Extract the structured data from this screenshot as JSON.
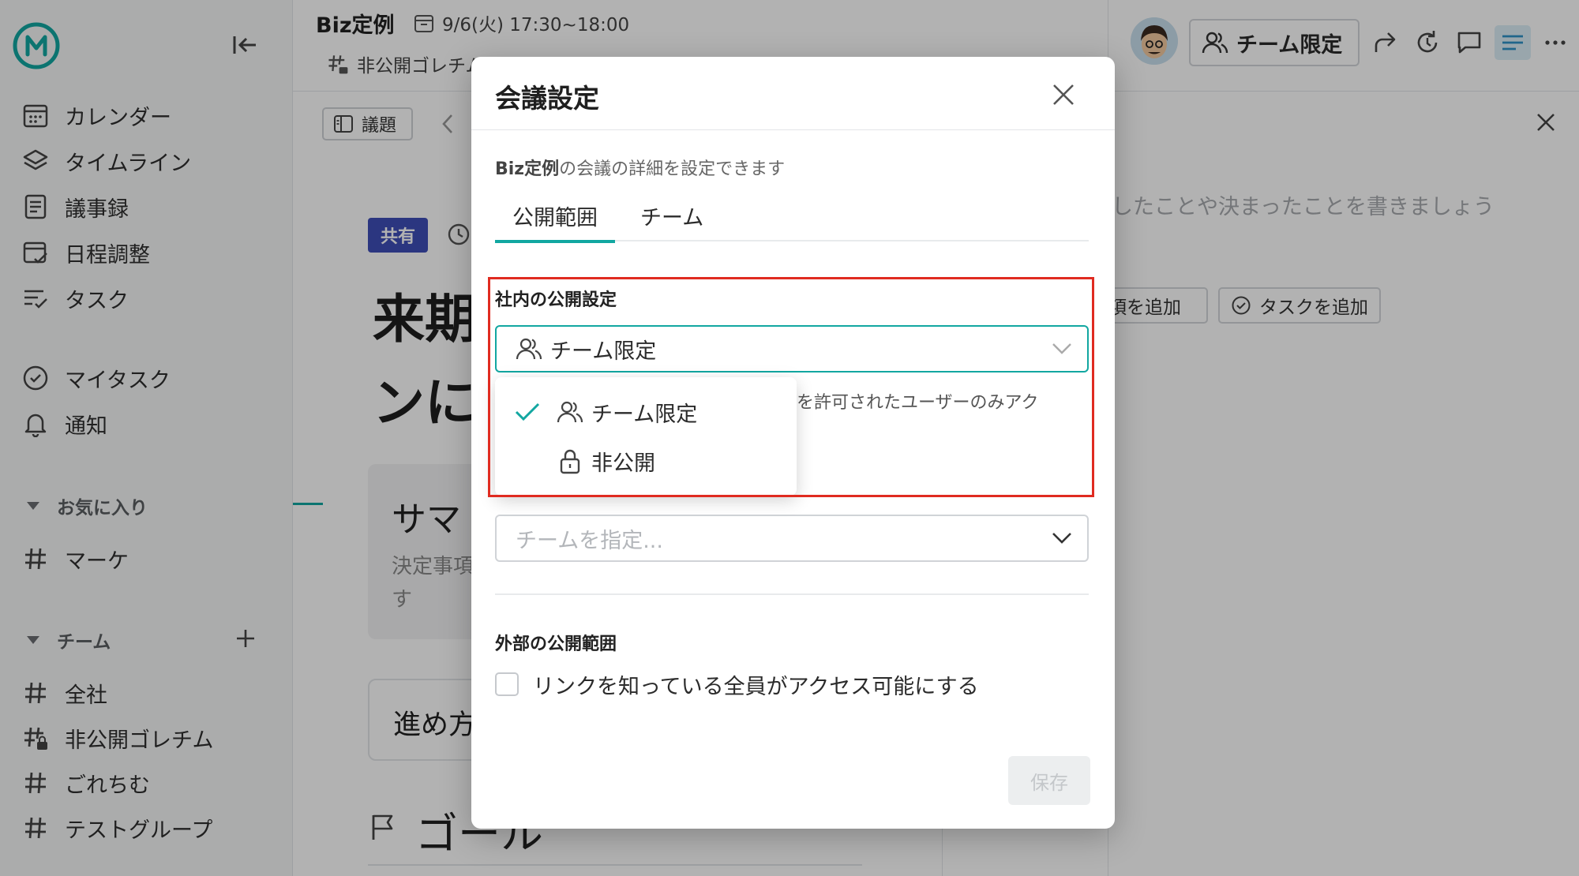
{
  "app": {
    "brand_color": "#12a7a1"
  },
  "sidebar": {
    "nav": [
      {
        "label": "カレンダー",
        "icon": "calendar-icon"
      },
      {
        "label": "タイムライン",
        "icon": "layers-icon"
      },
      {
        "label": "議事録",
        "icon": "document-icon"
      },
      {
        "label": "日程調整",
        "icon": "schedule-icon"
      },
      {
        "label": "タスク",
        "icon": "task-list-icon"
      }
    ],
    "personal": [
      {
        "label": "マイタスク",
        "icon": "check-circle-icon"
      },
      {
        "label": "通知",
        "icon": "bell-icon"
      }
    ],
    "favorites_header": "お気に入り",
    "favorites": [
      {
        "label": "マーケ",
        "icon": "hash-icon"
      }
    ],
    "teams_header": "チーム",
    "teams": [
      {
        "label": "全社",
        "icon": "hash-icon"
      },
      {
        "label": "非公開ゴレチム",
        "icon": "hash-lock-icon"
      },
      {
        "label": "ごれちむ",
        "icon": "hash-icon"
      },
      {
        "label": "テストグループ",
        "icon": "hash-icon"
      }
    ]
  },
  "header": {
    "meeting_title": "Biz定例",
    "meeting_datetime": "9/6(火) 17:30~18:00",
    "meeting_team": "非公開ゴレチム",
    "scope_button_label": "チーム限定"
  },
  "main": {
    "agenda_button": "議題",
    "share_badge": "共有",
    "title_line1": "来期",
    "title_line2": "ンに",
    "summary_title": "サマ",
    "summary_text": "決定事項す",
    "progress_title": "進め方",
    "goal_title": "ゴール"
  },
  "right_panel": {
    "placeholder": "したことや決まったことを書きましょう",
    "add_item_button": "項を追加",
    "add_task_button": "タスクを追加"
  },
  "modal": {
    "title": "会議設定",
    "description_name": "Biz定例",
    "description_rest": "の会議の詳細を設定できます",
    "tabs": [
      {
        "label": "公開範囲",
        "active": true
      },
      {
        "label": "チーム",
        "active": false
      }
    ],
    "internal_label": "社内の公開設定",
    "internal_selected": "チーム限定",
    "internal_help": "スを許可されたユーザーのみアク",
    "dropdown_options": [
      {
        "label": "チーム限定",
        "selected": true,
        "icon": "users-icon"
      },
      {
        "label": "非公開",
        "selected": false,
        "icon": "lock-icon"
      }
    ],
    "team_placeholder": "チームを指定...",
    "external_label": "外部の公開範囲",
    "external_checkbox_label": "リンクを知っている全員がアクセス可能にする",
    "external_checked": false,
    "save_button": "保存"
  }
}
